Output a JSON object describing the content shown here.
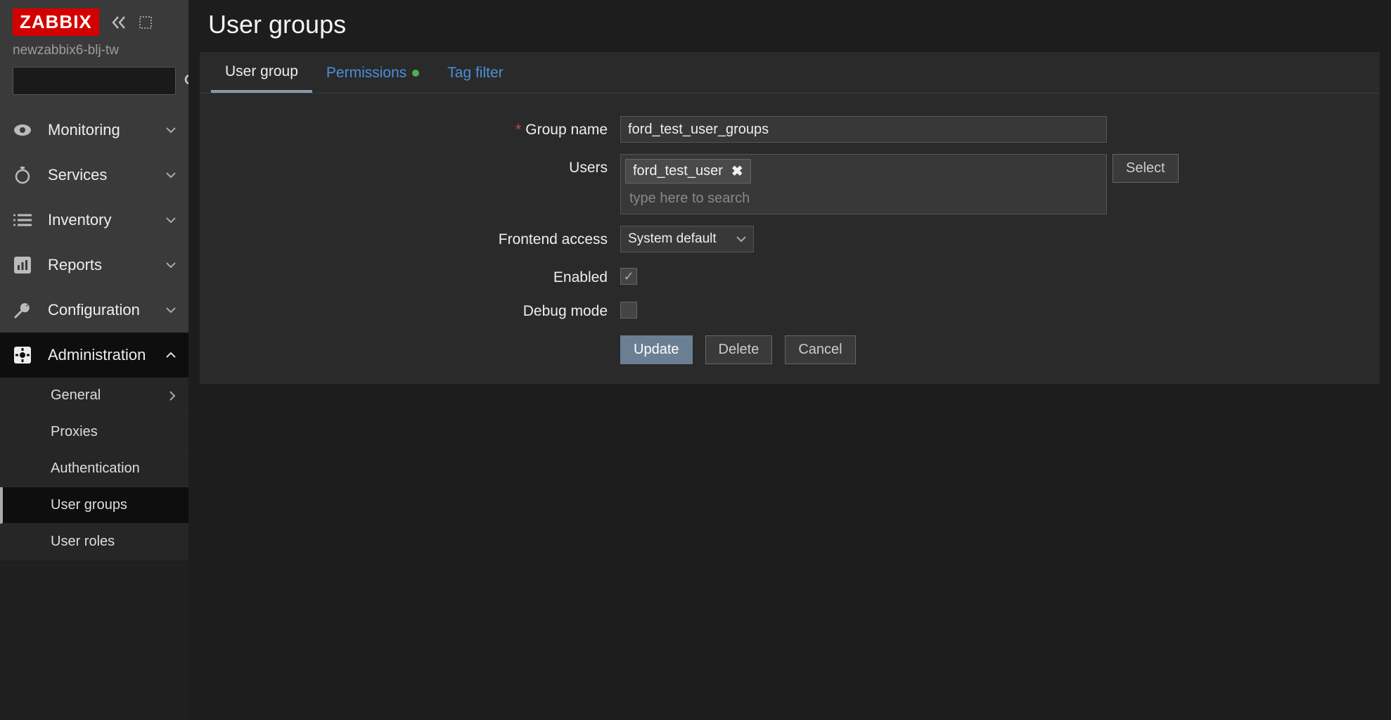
{
  "brand": "ZABBIX",
  "server_name": "newzabbix6-blj-tw",
  "page_title": "User groups",
  "sidebar": {
    "items": [
      {
        "label": "Monitoring"
      },
      {
        "label": "Services"
      },
      {
        "label": "Inventory"
      },
      {
        "label": "Reports"
      },
      {
        "label": "Configuration"
      },
      {
        "label": "Administration"
      }
    ],
    "admin_sub": [
      {
        "label": "General",
        "has_arrow": true
      },
      {
        "label": "Proxies"
      },
      {
        "label": "Authentication"
      },
      {
        "label": "User groups",
        "active": true
      },
      {
        "label": "User roles"
      }
    ]
  },
  "tabs": {
    "user_group": "User group",
    "permissions": "Permissions",
    "tag_filter": "Tag filter"
  },
  "form": {
    "group_name_label": "Group name",
    "group_name_value": "ford_test_user_groups",
    "users_label": "Users",
    "user_chip": "ford_test_user",
    "users_placeholder": "type here to search",
    "select_button": "Select",
    "frontend_access_label": "Frontend access",
    "frontend_access_value": "System default",
    "enabled_label": "Enabled",
    "debug_mode_label": "Debug mode",
    "update": "Update",
    "delete": "Delete",
    "cancel": "Cancel"
  }
}
